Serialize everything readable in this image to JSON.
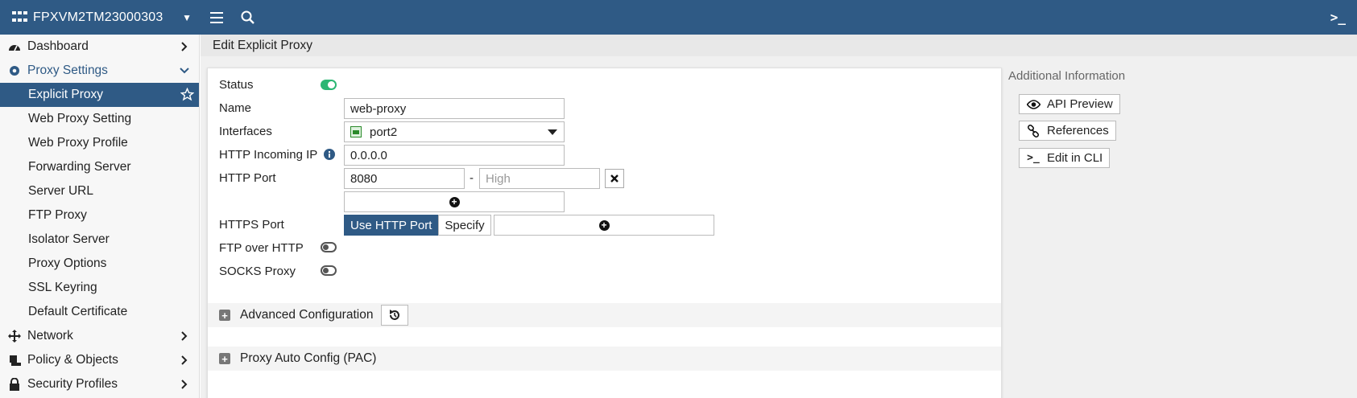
{
  "topbar": {
    "device_name": "FPXVM2TM23000303",
    "cli_glyph": ">_"
  },
  "sidebar": {
    "items": [
      {
        "label": "Dashboard",
        "icon": "dashboard-gauge-icon",
        "type": "top",
        "expanded": false
      },
      {
        "label": "Proxy Settings",
        "icon": "gear-icon",
        "type": "section",
        "expanded": true
      },
      {
        "label": "Explicit Proxy",
        "type": "sub",
        "active": true
      },
      {
        "label": "Web Proxy Setting",
        "type": "sub"
      },
      {
        "label": "Web Proxy Profile",
        "type": "sub"
      },
      {
        "label": "Forwarding Server",
        "type": "sub"
      },
      {
        "label": "Server URL",
        "type": "sub"
      },
      {
        "label": "FTP Proxy",
        "type": "sub"
      },
      {
        "label": "Isolator Server",
        "type": "sub"
      },
      {
        "label": "Proxy Options",
        "type": "sub"
      },
      {
        "label": "SSL Keyring",
        "type": "sub"
      },
      {
        "label": "Default Certificate",
        "type": "sub"
      },
      {
        "label": "Network",
        "icon": "move-arrows-icon",
        "type": "top",
        "expanded": false
      },
      {
        "label": "Policy & Objects",
        "icon": "policy-stamp-icon",
        "type": "top",
        "expanded": false
      },
      {
        "label": "Security Profiles",
        "icon": "lock-icon",
        "type": "top",
        "expanded": false
      }
    ]
  },
  "main": {
    "title": "Edit Explicit Proxy",
    "form": {
      "status_label": "Status",
      "status_on": true,
      "name_label": "Name",
      "name_value": "web-proxy",
      "interfaces_label": "Interfaces",
      "interfaces_value": "port2",
      "incoming_ip_label": "HTTP Incoming IP",
      "incoming_ip_value": "0.0.0.0",
      "http_port_label": "HTTP Port",
      "http_port_low": "8080",
      "http_port_dash": "-",
      "http_port_high_placeholder": "High",
      "https_port_label": "HTTPS Port",
      "https_port_options": [
        "Use HTTP Port",
        "Specify"
      ],
      "https_port_selected": "Use HTTP Port",
      "ftp_over_http_label": "FTP over HTTP",
      "ftp_over_http_on": false,
      "socks_proxy_label": "SOCKS Proxy",
      "socks_proxy_on": false
    },
    "sections": {
      "advanced": "Advanced Configuration",
      "pac": "Proxy Auto Config (PAC)"
    }
  },
  "info": {
    "title": "Additional Information",
    "buttons": [
      {
        "label": "API Preview",
        "icon": "eye-icon"
      },
      {
        "label": "References",
        "icon": "link-icon"
      },
      {
        "label": "Edit in CLI",
        "icon": "terminal-icon"
      }
    ]
  },
  "colors": {
    "topbar": "#2f5a85",
    "accent": "#2f5a85",
    "toggle_on": "#2bb673"
  }
}
